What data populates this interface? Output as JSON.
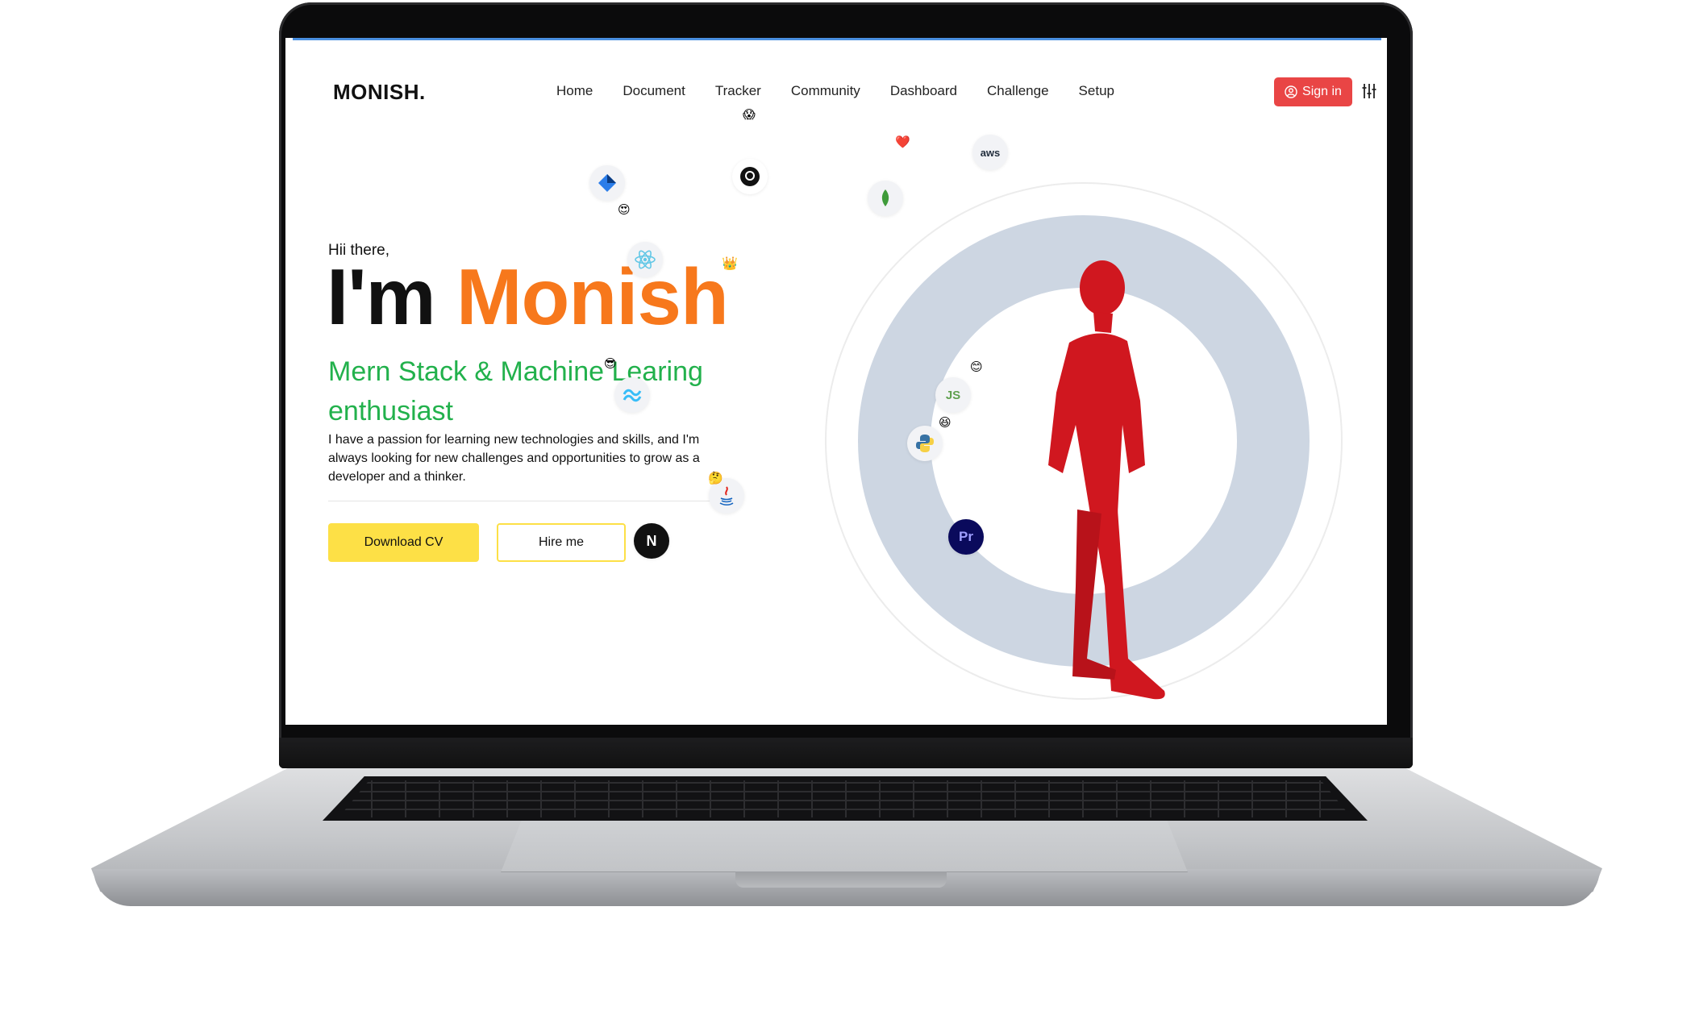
{
  "site": {
    "logo": "MONISH.",
    "nav": [
      "Home",
      "Document",
      "Tracker",
      "Community",
      "Dashboard",
      "Challenge",
      "Setup"
    ],
    "signin_label": "Sign in"
  },
  "hero": {
    "greeting": "Hii there,",
    "name_prefix": "I'm ",
    "name_accent": "Monish",
    "role": "Mern Stack & Machine Learing enthusiast",
    "description": "I have a passion for learning new technologies and skills, and I'm always looking for new challenges and opportunities to grow as a developer and a thinker.",
    "download_cv_label": "Download CV",
    "hire_me_label": "Hire me"
  },
  "tech_icons": {
    "aws": "aws",
    "node": "JS",
    "next": "N",
    "premiere": "Pr"
  },
  "colors": {
    "accent_orange": "#f7781c",
    "role_green": "#22b14c",
    "button_yellow": "#fde046",
    "signin_red": "#e94545",
    "figure_red": "#d0171f",
    "orbit_ring": "#cdd6e2"
  }
}
